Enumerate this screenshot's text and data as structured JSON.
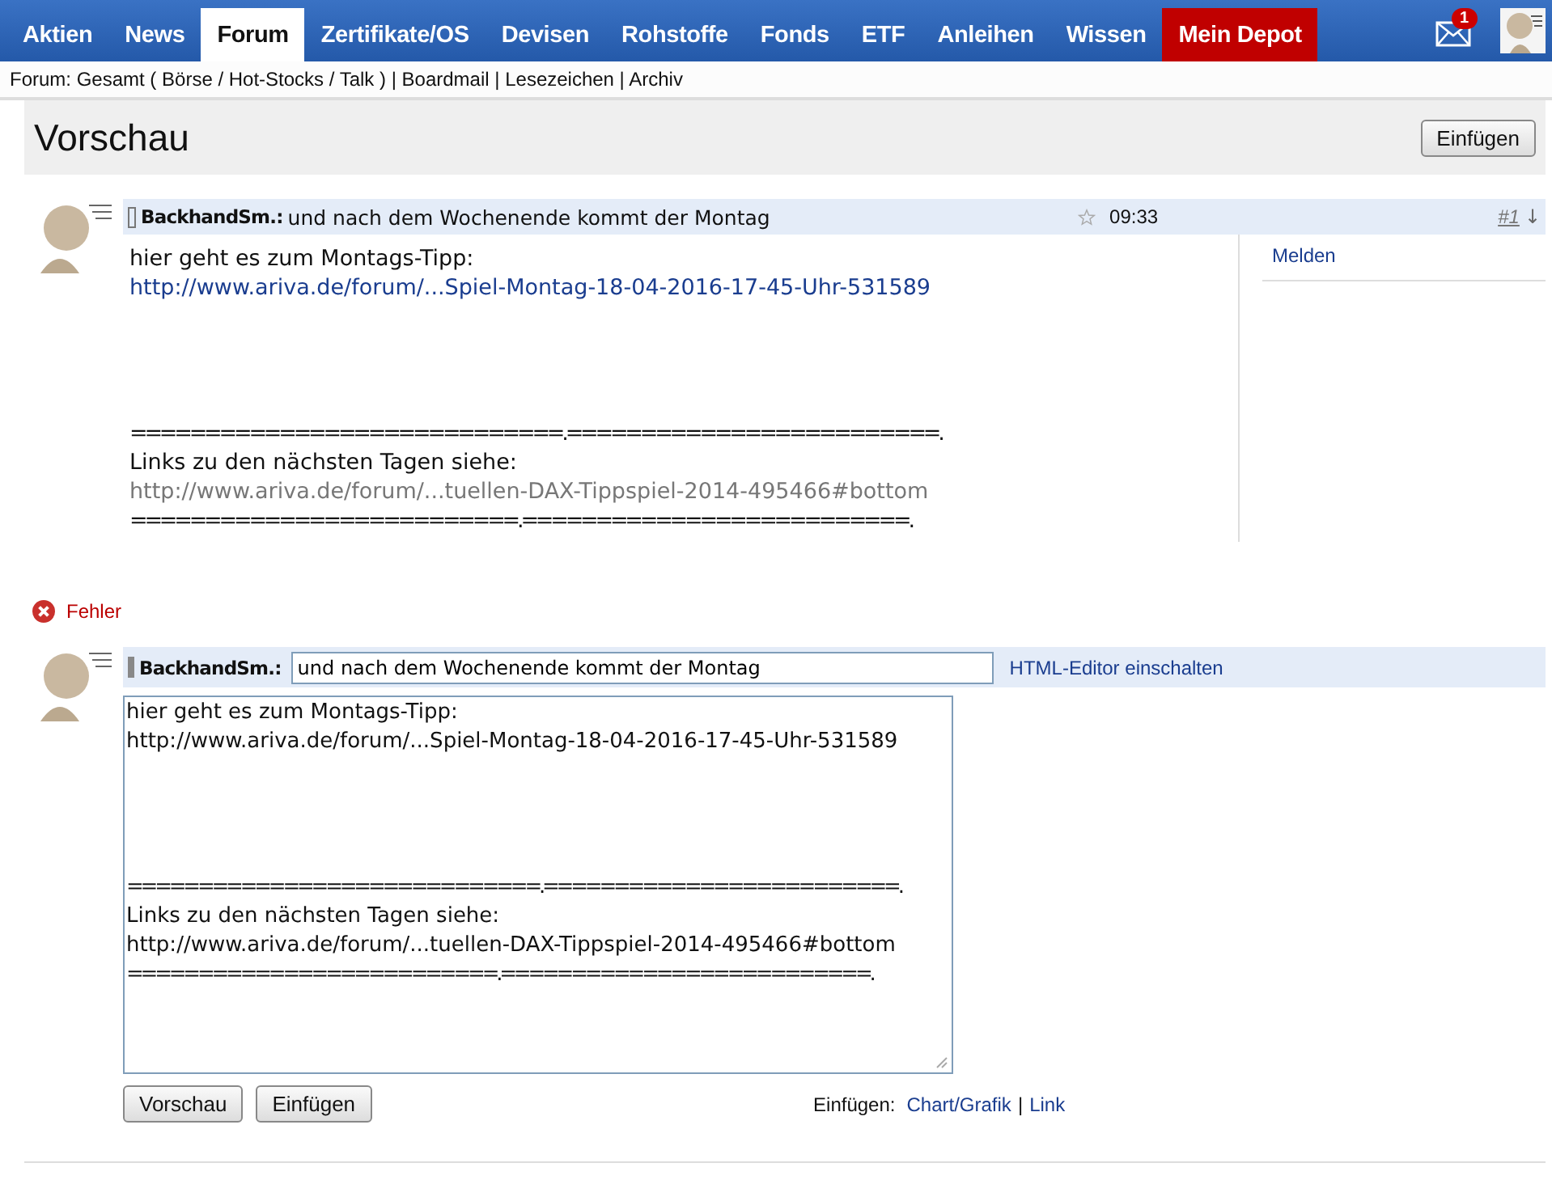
{
  "nav": {
    "tabs": [
      {
        "label": "Aktien",
        "selected": false,
        "kind": "normal"
      },
      {
        "label": "News",
        "selected": false,
        "kind": "normal"
      },
      {
        "label": "Forum",
        "selected": true,
        "kind": "normal"
      },
      {
        "label": "Zertifikate/OS",
        "selected": false,
        "kind": "normal"
      },
      {
        "label": "Devisen",
        "selected": false,
        "kind": "normal"
      },
      {
        "label": "Rohstoffe",
        "selected": false,
        "kind": "normal"
      },
      {
        "label": "Fonds",
        "selected": false,
        "kind": "normal"
      },
      {
        "label": "ETF",
        "selected": false,
        "kind": "normal"
      },
      {
        "label": "Anleihen",
        "selected": false,
        "kind": "normal"
      },
      {
        "label": "Wissen",
        "selected": false,
        "kind": "normal"
      },
      {
        "label": "Mein Depot",
        "selected": false,
        "kind": "depot"
      }
    ],
    "mail_badge": "1"
  },
  "breadcrumb": "Forum: Gesamt ( Börse / Hot-Stocks / Talk ) | Boardmail | Lesezeichen | Archiv",
  "preview": {
    "title": "Vorschau",
    "button": "Einfügen"
  },
  "post": {
    "author": "BackhandSm.:",
    "subject": "und nach dem Wochenende kommt der Montag",
    "time": "09:33",
    "number": "#1",
    "arrow": "↓",
    "report": "Melden",
    "lines": [
      {
        "kind": "text",
        "text": "hier geht es zum Montags-Tipp:"
      },
      {
        "kind": "link",
        "text": "http://www.ariva.de/forum/...Spiel-Montag-18-04-2016-17-45-Uhr-531589"
      },
      {
        "kind": "blank"
      },
      {
        "kind": "blank"
      },
      {
        "kind": "blank"
      },
      {
        "kind": "blank"
      },
      {
        "kind": "rule",
        "text": "=============================.=========================."
      },
      {
        "kind": "text",
        "text": "Links zu den nächsten Tagen siehe:"
      },
      {
        "kind": "visited",
        "text": "http://www.ariva.de/forum/...tuellen-DAX-Tippspiel-2014-495466#bottom"
      },
      {
        "kind": "rule",
        "text": "==========================.==========================."
      }
    ]
  },
  "error": "Fehler",
  "editor": {
    "author": "BackhandSm.:",
    "subject": "und nach dem Wochenende kommt der Montag",
    "html_toggle": "HTML-Editor einschalten",
    "body": [
      {
        "kind": "text",
        "text": "hier geht es zum Montags-Tipp:"
      },
      {
        "kind": "text",
        "text": "http://www.ariva.de/forum/...Spiel-Montag-18-04-2016-17-45-Uhr-531589"
      },
      {
        "kind": "blank"
      },
      {
        "kind": "blank"
      },
      {
        "kind": "blank"
      },
      {
        "kind": "blank"
      },
      {
        "kind": "rule",
        "text": "=============================.=========================."
      },
      {
        "kind": "text",
        "text": "Links zu den nächsten Tagen siehe:"
      },
      {
        "kind": "text",
        "text": "http://www.ariva.de/forum/...tuellen-DAX-Tippspiel-2014-495466#bottom"
      },
      {
        "kind": "rule",
        "text": "==========================.==========================."
      }
    ],
    "buttons": [
      "Vorschau",
      "Einfügen"
    ],
    "insert_label": "Einfügen:",
    "insert_links": [
      "Chart/Grafik",
      "Link"
    ],
    "separator": "|"
  }
}
